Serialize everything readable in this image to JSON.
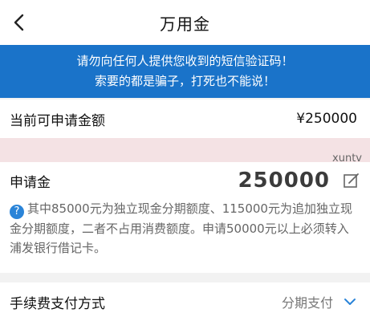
{
  "header": {
    "title": "万用金"
  },
  "warning": {
    "line1": "请勿向任何人提供您收到的短信验证码！",
    "line2": "索要的都是骗子，打死也不能说！"
  },
  "available": {
    "label": "当前可申请金额",
    "value": "¥250000"
  },
  "apply": {
    "label": "申请金",
    "amount": "250000"
  },
  "watermark": "xuntv",
  "note": {
    "icon": "?",
    "text": "其中85000元为独立现金分期额度、115000元为追加独立现金分期额度，二者不占用消费额度。申请50000元以上必须转入浦发银行借记卡。"
  },
  "fee": {
    "label": "手续费支付方式",
    "value": "分期支付"
  },
  "colors": {
    "accent": "#1a73c9"
  },
  "icons": {
    "back": "back-arrow-icon",
    "edit": "edit-icon",
    "chevron": "chevron-down-icon",
    "help": "question-icon"
  }
}
